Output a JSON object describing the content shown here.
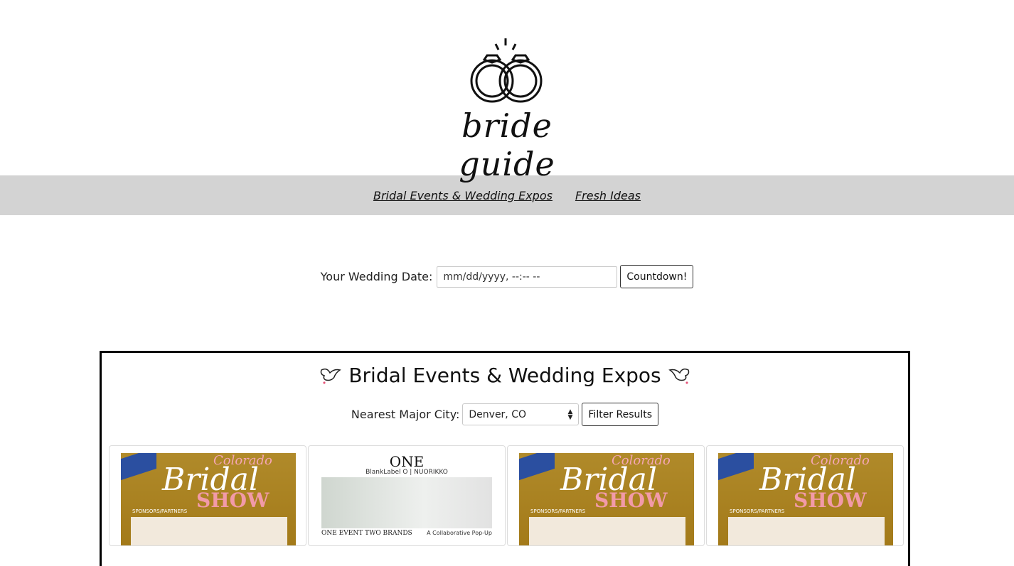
{
  "brand": {
    "logo_text": "bride guide"
  },
  "nav": {
    "items": [
      {
        "label": "Bridal Events & Wedding Expos"
      },
      {
        "label": "Fresh Ideas"
      }
    ]
  },
  "countdown": {
    "label": "Your Wedding Date:",
    "placeholder": "mm/dd/yyyy, --:-- --",
    "button": "Countdown!"
  },
  "events": {
    "title": "Bridal Events & Wedding Expos",
    "city_label": "Nearest Major City:",
    "city_selected": "Denver, CO",
    "filter_button": "Filter Results",
    "cards": [
      {
        "poster": {
          "top": "Colorado",
          "title": "Bridal",
          "sub": "SHOW",
          "note": "SPONSORS/PARTNERS"
        }
      },
      {
        "poster": {
          "top": "ONE",
          "brands": "BlankLabel O | NUORIKKO",
          "tagline": "ONE EVENT TWO BRANDS",
          "right": "A Collaborative Pop-Up"
        }
      },
      {
        "poster": {
          "top": "Colorado",
          "title": "Bridal",
          "sub": "SHOW",
          "note": "SPONSORS/PARTNERS"
        }
      },
      {
        "poster": {
          "top": "Colorado",
          "title": "Bridal",
          "sub": "SHOW",
          "note": "SPONSORS/PARTNERS"
        }
      }
    ]
  }
}
